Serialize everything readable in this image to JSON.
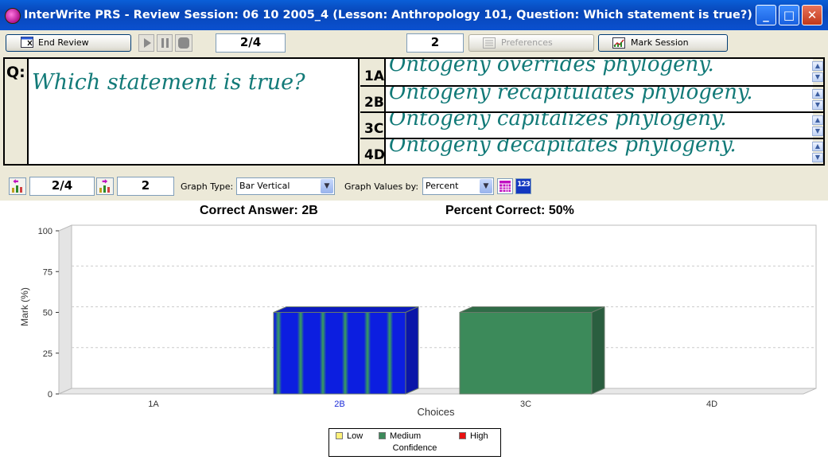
{
  "window": {
    "title": "InterWrite PRS - Review Session: 06 10 2005_4 (Lesson: Anthropology 101, Question: Which statement is true?)"
  },
  "toolbar": {
    "end_review_label": "End Review",
    "question_index": "2/4",
    "responses_count": "2",
    "preferences_label": "Preferences",
    "mark_session_label": "Mark Session"
  },
  "question": {
    "label": "Q:",
    "text": "Which statement is true?"
  },
  "answers": [
    {
      "label": "1A:",
      "text": "Ontogeny overrides phylogeny."
    },
    {
      "label": "2B:",
      "text": "Ontogeny recapitulates phylogeny."
    },
    {
      "label": "3C:",
      "text": "Ontogeny capitalizes phylogeny."
    },
    {
      "label": "4D:",
      "text": "Ontogeny decapitates phylogeny."
    }
  ],
  "graph_toolbar": {
    "question_index": "2/4",
    "responses_count": "2",
    "graph_type_label": "Graph Type:",
    "graph_type_value": "Bar Vertical",
    "graph_values_label": "Graph Values by:",
    "graph_values_value": "Percent"
  },
  "chart_data": {
    "type": "bar",
    "correct_answer_text": "Correct Answer: 2B",
    "percent_correct_text": "Percent Correct: 50%",
    "categories": [
      "1A",
      "2B",
      "3C",
      "4D"
    ],
    "values": [
      0,
      50,
      50,
      0
    ],
    "highlight_category": "2B",
    "xlabel": "Choices",
    "ylabel": "Mark (%)",
    "ylim": [
      0,
      100
    ],
    "yticks": [
      0,
      25,
      50,
      75,
      100
    ],
    "grid": true,
    "bar_colors": [
      "#3c8a5a",
      "#1a2ad8",
      "#3c8a5a",
      "#3c8a5a"
    ],
    "legend": {
      "items": [
        {
          "name": "Low",
          "color": "#fff17a"
        },
        {
          "name": "Medium",
          "color": "#3c8a5a"
        },
        {
          "name": "High",
          "color": "#e81010"
        }
      ],
      "caption": "Confidence",
      "placement": "bottom-center"
    }
  }
}
